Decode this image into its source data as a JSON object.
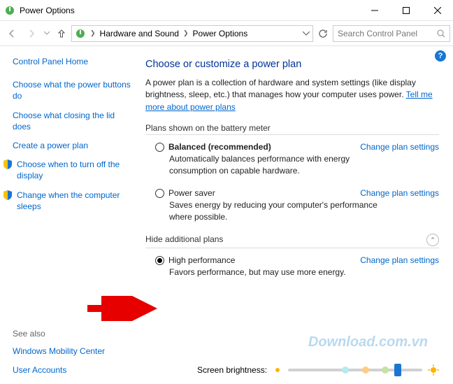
{
  "window": {
    "title": "Power Options"
  },
  "breadcrumb": {
    "b1": "Hardware and Sound",
    "b2": "Power Options"
  },
  "search": {
    "placeholder": "Search Control Panel"
  },
  "sidebar": {
    "home": "Control Panel Home",
    "link1": "Choose what the power buttons do",
    "link2": "Choose what closing the lid does",
    "link3": "Create a power plan",
    "link4": "Choose when to turn off the display",
    "link5": "Change when the computer sleeps",
    "seealso": "See also",
    "link6": "Windows Mobility Center",
    "link7": "User Accounts"
  },
  "main": {
    "heading": "Choose or customize a power plan",
    "desc_a": "A power plan is a collection of hardware and system settings (like display brightness, sleep, etc.) that manages how your computer uses power. ",
    "desc_link": "Tell me more about power plans",
    "section1": "Plans shown on the battery meter",
    "plan1": {
      "name": "Balanced (recommended)",
      "link": "Change plan settings",
      "desc": "Automatically balances performance with energy consumption on capable hardware."
    },
    "plan2": {
      "name": "Power saver",
      "link": "Change plan settings",
      "desc": "Saves energy by reducing your computer's performance where possible."
    },
    "hide": "Hide additional plans",
    "plan3": {
      "name": "High performance",
      "link": "Change plan settings",
      "desc": "Favors performance, but may use more energy."
    },
    "brightness_label": "Screen brightness:"
  },
  "watermark": "Download.com.vn"
}
